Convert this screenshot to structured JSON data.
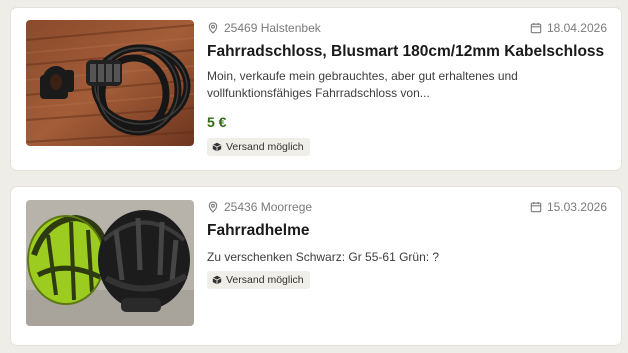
{
  "listings": [
    {
      "location": "25469 Halstenbek",
      "date": "18.04.2026",
      "title": "Fahrradschloss, Blusmart 180cm/12mm Kabelschloss",
      "description": "Moin, verkaufe mein gebrauchtes, aber gut erhaltenes und vollfunktionsfähiges Fahrradschloss von...",
      "price": "5 €",
      "badge": "Versand möglich",
      "image_icon": "bike-lock-photo"
    },
    {
      "location": "25436 Moorrege",
      "date": "15.03.2026",
      "title": "Fahrradhelme",
      "description": "Zu verschenken Schwarz: Gr 55-61 Grün: ?",
      "badge": "Versand möglich",
      "image_icon": "bike-helmets-photo"
    }
  ],
  "colors": {
    "price": "#326916",
    "background": "#efede7",
    "card": "#ffffff"
  }
}
